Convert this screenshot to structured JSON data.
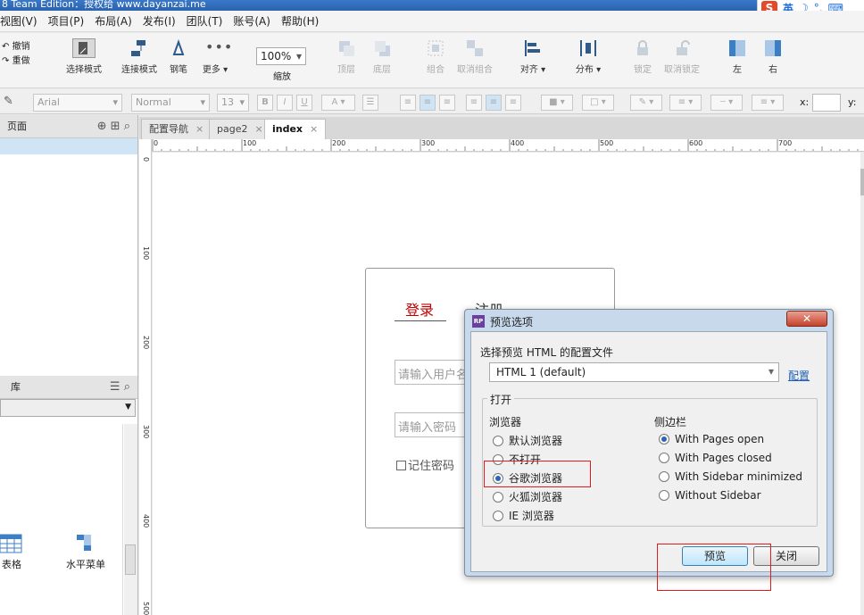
{
  "window": {
    "title": "8 Team Edition：授权给 www.dayanzai.me",
    "ime": {
      "brand": "S",
      "mode": "英",
      "icons": [
        "moon-icon",
        "punctuation-icon",
        "keyboard-icon"
      ]
    }
  },
  "menu": [
    "视图(V)",
    "项目(P)",
    "布局(A)",
    "发布(I)",
    "团队(T)",
    "账号(A)",
    "帮助(H)"
  ],
  "toolbar": {
    "undo": "撤销",
    "redo": "重做",
    "select_mode": "选择模式",
    "connect_mode": "连接模式",
    "pen": "钢笔",
    "more": "更多 ▾",
    "zoom_value": "100%",
    "zoom_label": "缩放",
    "top": "顶层",
    "bottom": "底层",
    "group": "组合",
    "ungroup": "取消组合",
    "align": "对齐 ▾",
    "distribute": "分布 ▾",
    "lock": "锁定",
    "unlock": "取消锁定",
    "left": "左",
    "right": "右"
  },
  "format": {
    "font": "Arial",
    "style": "Normal",
    "size": "13",
    "bold": "B",
    "italic": "I",
    "underline": "U",
    "x_label": "x:",
    "y_label": "y:"
  },
  "left_panel": {
    "pages_title": "页面",
    "library_title": "库",
    "library_items": [
      "表格",
      "水平菜单"
    ]
  },
  "tabs": [
    {
      "label": "配置导航",
      "active": false
    },
    {
      "label": "page2",
      "active": false
    },
    {
      "label": "index",
      "active": true
    }
  ],
  "tab_close": "×",
  "ruler": {
    "h": [
      "0",
      "100",
      "200",
      "300",
      "400",
      "500",
      "600",
      "700"
    ],
    "v": [
      "0",
      "100",
      "200",
      "300",
      "400",
      "500"
    ]
  },
  "canvas": {
    "login_tab": "登录",
    "register_tab": "注册",
    "username_placeholder": "请输入用户名",
    "password_placeholder": "请输入密码",
    "remember": "记住密码"
  },
  "dialog": {
    "title": "预览选项",
    "logo": "RP",
    "close": "✕",
    "config_label": "选择预览 HTML 的配置文件",
    "config_value": "HTML 1 (default)",
    "config_link": "配置",
    "open_label": "打开",
    "browser_label": "浏览器",
    "browsers": [
      {
        "label": "默认浏览器",
        "checked": false
      },
      {
        "label": "不打开",
        "checked": false
      },
      {
        "label": "谷歌浏览器",
        "checked": true
      },
      {
        "label": "火狐浏览器",
        "checked": false
      },
      {
        "label": "IE 浏览器",
        "checked": false
      }
    ],
    "sidebar_label": "侧边栏",
    "sidebar_options": [
      {
        "label": "With Pages open",
        "checked": true
      },
      {
        "label": "With Pages closed",
        "checked": false
      },
      {
        "label": "With Sidebar minimized",
        "checked": false
      },
      {
        "label": "Without Sidebar",
        "checked": false
      }
    ],
    "preview_button": "预览",
    "close_button": "关闭"
  }
}
